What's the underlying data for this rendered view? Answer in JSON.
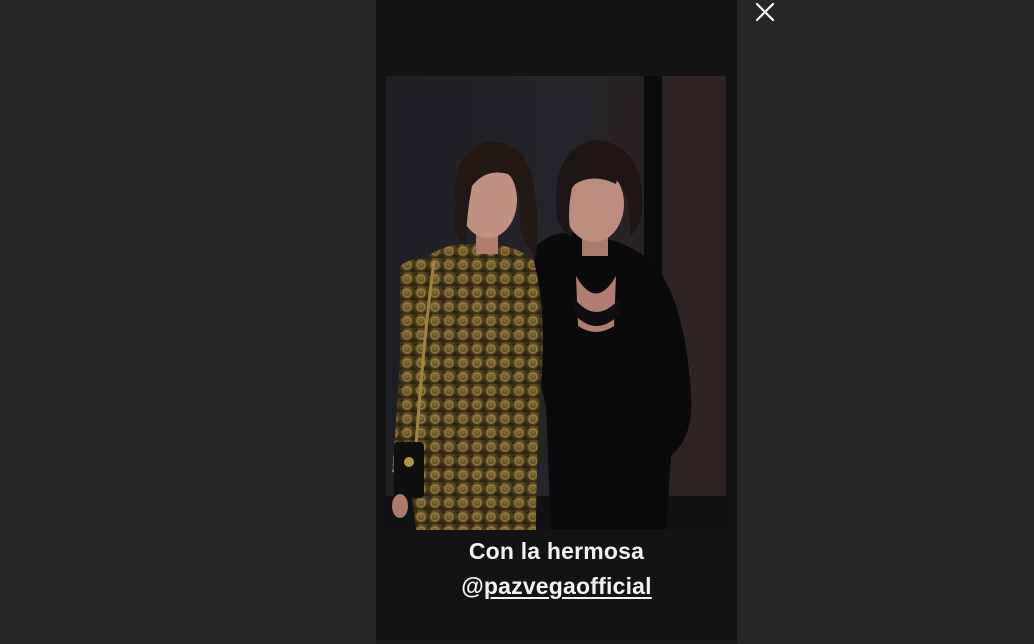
{
  "story": {
    "caption_line1": "Con la hermosa",
    "mention_at": "@",
    "mention_handle": "pazvegaofficial"
  },
  "controls": {
    "close_icon": "close-icon"
  },
  "colors": {
    "page_background": "#262626",
    "story_background": "#131313",
    "caption_text": "#f2f2f2"
  }
}
